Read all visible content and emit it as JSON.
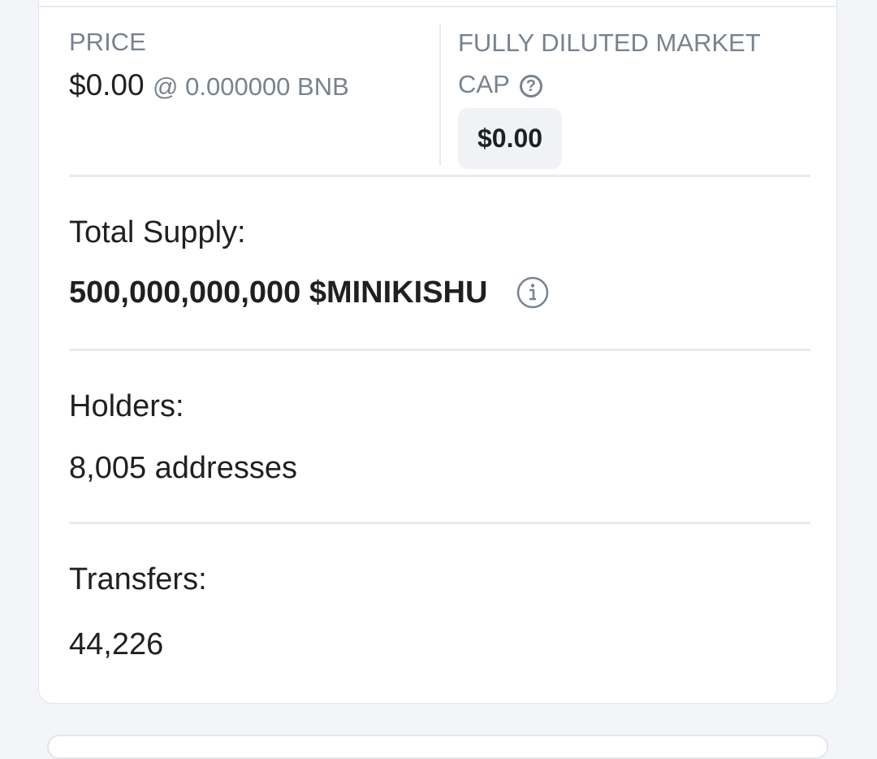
{
  "price": {
    "label": "PRICE",
    "value": "$0.00",
    "bnb": "@ 0.000000 BNB"
  },
  "fdmc": {
    "label": "FULLY DILUTED MARKET CAP",
    "help_icon": "question-circle-icon",
    "value": "$0.00"
  },
  "total_supply": {
    "label": "Total Supply:",
    "value": "500,000,000,000 $MINIKISHU",
    "info_icon": "info-circle-icon"
  },
  "holders": {
    "label": "Holders:",
    "value": "8,005 addresses"
  },
  "transfers": {
    "label": "Transfers:",
    "value": "44,226"
  },
  "colors": {
    "text_primary": "#1e2022",
    "text_muted": "#77838f",
    "divider": "#e7eaf0",
    "badge_bg": "#f1f2f5",
    "page_bg": "#f4f5f8"
  }
}
